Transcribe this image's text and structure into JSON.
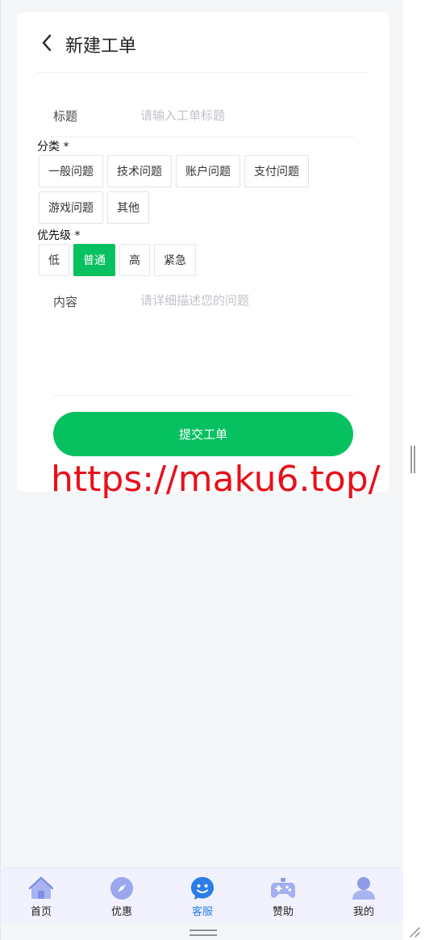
{
  "header": {
    "title": "新建工单"
  },
  "form": {
    "title_label": "标题",
    "title_placeholder": "请输入工单标题",
    "category_label": "分类 *",
    "categories": [
      "一般问题",
      "技术问题",
      "账户问题",
      "支付问题",
      "游戏问题",
      "其他"
    ],
    "priority_label": "优先级 *",
    "priorities": [
      "低",
      "普通",
      "高",
      "紧急"
    ],
    "selected_priority": "普通",
    "content_label": "内容",
    "content_placeholder": "请详细描述您的问题",
    "submit_label": "提交工单"
  },
  "watermark": "https://maku6.top/",
  "tabbar": {
    "items": [
      {
        "label": "首页",
        "icon": "home-icon"
      },
      {
        "label": "优惠",
        "icon": "compass-icon"
      },
      {
        "label": "客服",
        "icon": "chat-face-icon"
      },
      {
        "label": "赞助",
        "icon": "gamepad-icon"
      },
      {
        "label": "我的",
        "icon": "user-icon"
      }
    ],
    "active": "客服"
  },
  "colors": {
    "accent": "#07c160",
    "tab_active": "#2a7ee6",
    "watermark": "#e8101a"
  }
}
